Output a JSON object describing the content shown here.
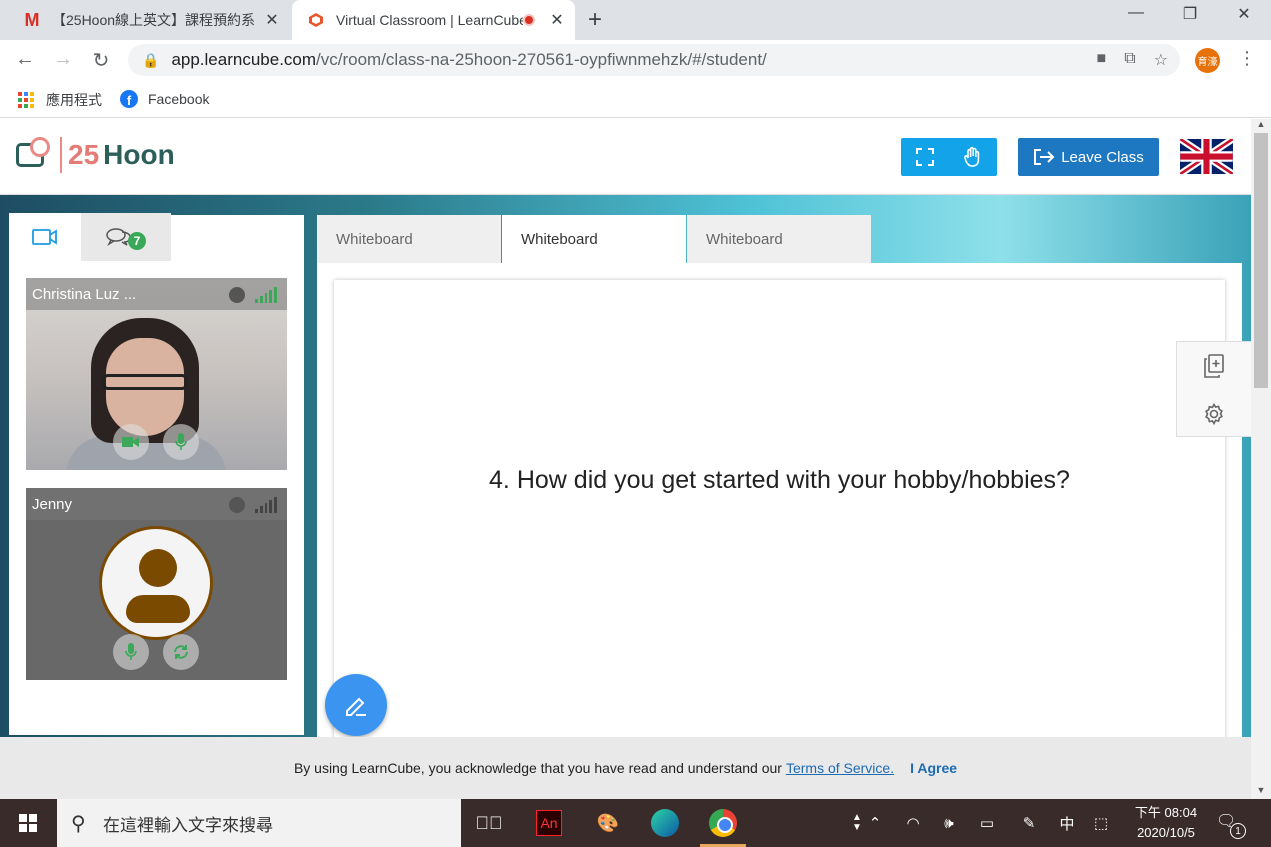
{
  "browser": {
    "tabs": [
      {
        "title": "【25Hoon線上英文】課程預約系",
        "favicon": "gmail-icon"
      },
      {
        "title": "Virtual Classroom | LearnCube",
        "favicon": "learncube-icon",
        "recording": true
      }
    ],
    "url_host": "app.learncube.com",
    "url_path": "/vc/room/class-na-25hoon-270561-oypfiwnmehzk/#/student/",
    "profile_label": "育濠",
    "bookmarks": [
      {
        "label": "應用程式",
        "icon": "apps-grid-icon"
      },
      {
        "label": "Facebook",
        "icon": "facebook-icon"
      }
    ]
  },
  "header": {
    "logo_num": "25",
    "logo_text": "Hoon",
    "leave_label": "Leave Class",
    "language_flag": "uk-flag-icon"
  },
  "left_panel": {
    "chat_count": "7",
    "participants": [
      {
        "name": "Christina Luz ...",
        "status_color": "#3aa858"
      },
      {
        "name": "Jenny",
        "status_color": "#444444"
      }
    ]
  },
  "whiteboard": {
    "tabs": [
      "Whiteboard",
      "Whiteboard",
      "Whiteboard"
    ],
    "active_tab": 1,
    "content": "4. How did you get started with your hobby/hobbies?"
  },
  "consent": {
    "text": "By using LearnCube, you acknowledge that you have read and understand our",
    "link": "Terms of Service.",
    "agree": "I Agree"
  },
  "taskbar": {
    "search_placeholder": "在這裡輸入文字來搜尋",
    "ime": "中",
    "time": "下午 08:04",
    "date": "2020/10/5",
    "notifications": "1"
  },
  "colors": {
    "accent_blue": "#12a3e8",
    "leave_blue": "#1d78c1",
    "fab_blue": "#3b95f0",
    "logo_coral": "#e47b76",
    "logo_teal": "#2c5f5a"
  }
}
